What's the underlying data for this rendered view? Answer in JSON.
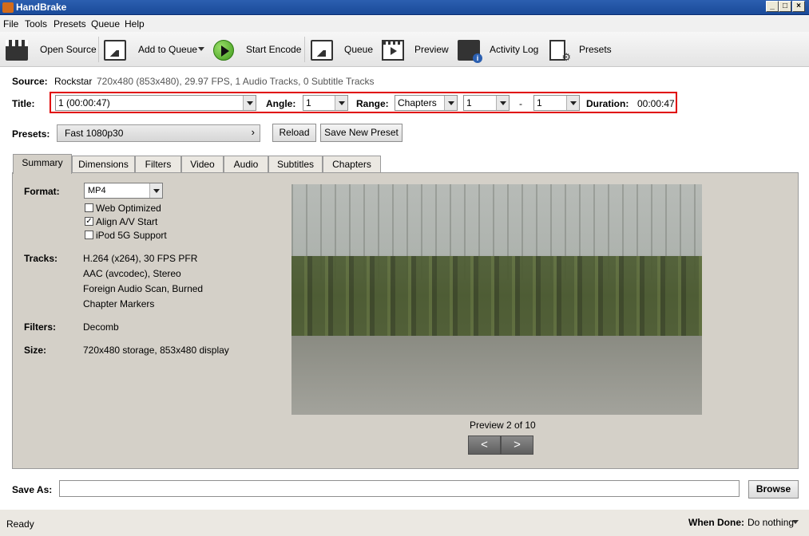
{
  "window": {
    "title": "HandBrake"
  },
  "menu": {
    "items": [
      "File",
      "Tools",
      "Presets",
      "Queue",
      "Help"
    ]
  },
  "toolbar": {
    "open_source": "Open Source",
    "add_to_queue": "Add to Queue",
    "start_encode": "Start Encode",
    "queue": "Queue",
    "preview": "Preview",
    "activity_log": "Activity Log",
    "presets": "Presets"
  },
  "source": {
    "label": "Source:",
    "name": "Rockstar",
    "info": "720x480 (853x480), 29.97 FPS, 1 Audio Tracks, 0 Subtitle Tracks"
  },
  "title_row": {
    "title_label": "Title:",
    "title_value": "1 (00:00:47)",
    "angle_label": "Angle:",
    "angle_value": "1",
    "range_label": "Range:",
    "range_value": "Chapters",
    "range_start": "1",
    "range_sep": "-",
    "range_end": "1",
    "duration_label": "Duration:",
    "duration_value": "00:00:47"
  },
  "presets_row": {
    "label": "Presets:",
    "value": "Fast 1080p30",
    "reload": "Reload",
    "save_new": "Save New Preset"
  },
  "tabs": [
    "Summary",
    "Dimensions",
    "Filters",
    "Video",
    "Audio",
    "Subtitles",
    "Chapters"
  ],
  "summary": {
    "format_label": "Format:",
    "format_value": "MP4",
    "web_optimized": {
      "label": "Web Optimized",
      "checked": false
    },
    "align_av": {
      "label": "Align A/V Start",
      "checked": true
    },
    "ipod": {
      "label": "iPod 5G Support",
      "checked": false
    },
    "tracks_label": "Tracks:",
    "tracks": [
      "H.264 (x264), 30 FPS PFR",
      "AAC (avcodec), Stereo",
      "Foreign Audio Scan, Burned",
      "Chapter Markers"
    ],
    "filters_label": "Filters:",
    "filters_value": "Decomb",
    "size_label": "Size:",
    "size_value": "720x480 storage, 853x480 display"
  },
  "preview": {
    "caption": "Preview 2 of 10",
    "prev": "<",
    "next": ">"
  },
  "save_as": {
    "label": "Save As:",
    "value": "",
    "browse": "Browse"
  },
  "status": {
    "text": "Ready",
    "when_done_label": "When Done:",
    "when_done_value": "Do nothing"
  }
}
